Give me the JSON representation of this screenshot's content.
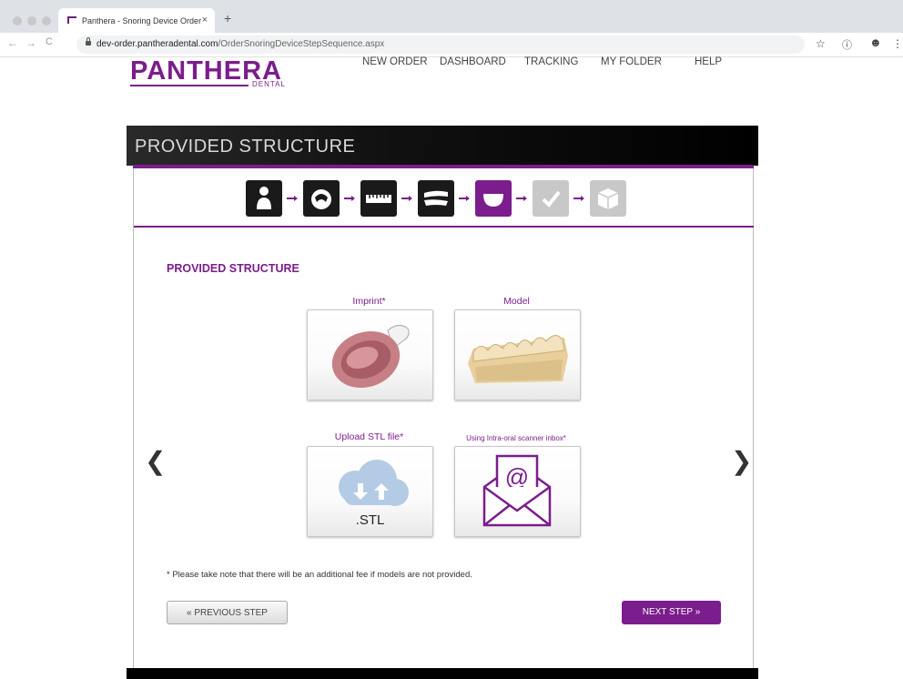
{
  "browser": {
    "tab_title": "Panthera - Snoring Device Order",
    "tab_close": "×",
    "new_tab": "+",
    "url_host": "dev-order.pantheradental.com",
    "url_path": "/OrderSnoringDeviceStepSequence.aspx",
    "back": "←",
    "forward": "→",
    "reload": "C",
    "star_icon": "☆",
    "info_icon": "ⓘ",
    "account_icon": "☻",
    "more_icon": "⋮"
  },
  "site": {
    "logo_main": "PANTHERA",
    "logo_sub": "DENTAL",
    "menu": [
      "NEW ORDER",
      "DASHBOARD",
      "TRACKING",
      "MY FOLDER",
      "HELP"
    ]
  },
  "panel": {
    "header_title": "PROVIDED STRUCTURE",
    "section_title": "PROVIDED STRUCTURE",
    "steps": [
      {
        "icon": "patient-icon",
        "state": "done"
      },
      {
        "icon": "teeth-icon",
        "state": "done"
      },
      {
        "icon": "ruler-icon",
        "state": "done"
      },
      {
        "icon": "jaw-icon",
        "state": "done"
      },
      {
        "icon": "mouthguard-icon",
        "state": "active"
      },
      {
        "icon": "check-icon",
        "state": "pending"
      },
      {
        "icon": "box-icon",
        "state": "pending"
      }
    ],
    "options": [
      {
        "label": "Imprint*",
        "icon": "imprint-tray-icon"
      },
      {
        "label": "Model",
        "icon": "dental-model-icon"
      },
      {
        "label": "Upload STL file*",
        "icon": "cloud-upload-icon",
        "card_text": ".STL"
      },
      {
        "label": "Using Intra-oral scanner inbox*",
        "icon": "email-envelope-icon"
      }
    ],
    "prev_arrow": "❮",
    "next_arrow": "❯",
    "note": "* Please take note that there will be an additional fee if models are not provided.",
    "prev_button": "« PREVIOUS STEP",
    "next_button": "NEXT STEP »"
  },
  "colors": {
    "accent": "#7b1d8c",
    "header_dark": "#111111"
  }
}
